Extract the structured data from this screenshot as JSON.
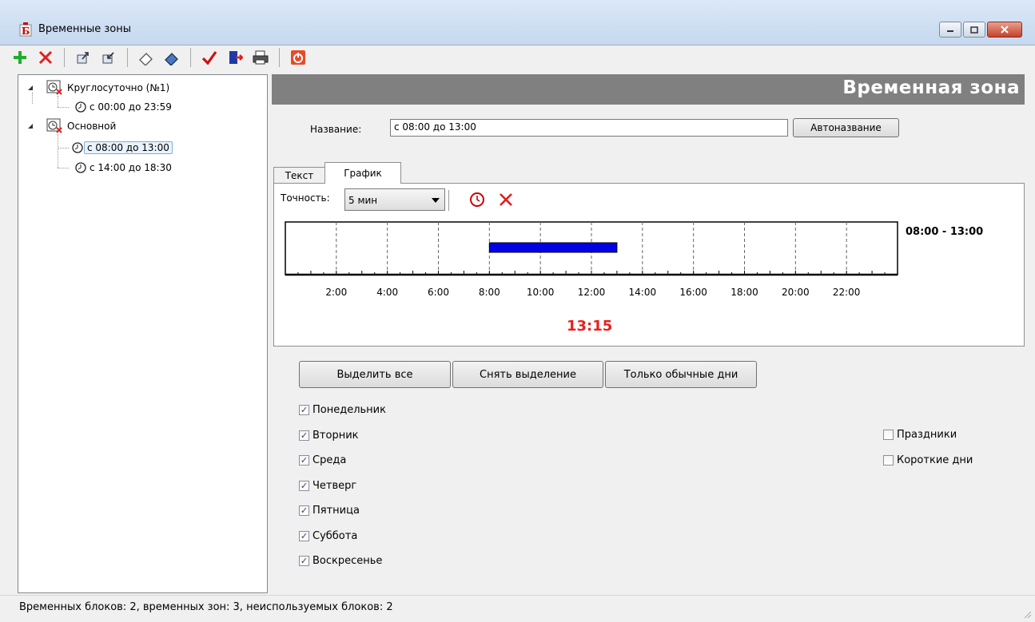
{
  "window": {
    "title": "Временные зоны"
  },
  "toolbar": {
    "buttons": [
      "add-icon",
      "delete-icon",
      "import-icon",
      "export-icon",
      "clear-icon",
      "edit-icon",
      "apply-icon",
      "exit-icon",
      "print-icon",
      "power-icon"
    ]
  },
  "tree": {
    "nodes": [
      {
        "label": "Круглосуточно (№1)",
        "type": "group"
      },
      {
        "label": "с 00:00 до 23:59",
        "type": "block"
      },
      {
        "label": "Основной",
        "type": "group"
      },
      {
        "label": "с 08:00 до 13:00",
        "type": "block",
        "selected": true
      },
      {
        "label": "с 14:00 до 18:30",
        "type": "block"
      }
    ]
  },
  "panel": {
    "header": "Временная зона",
    "name_label": "Название:",
    "name_value": "с 08:00 до 13:00",
    "autoname_button": "Автоназвание",
    "tabs": [
      "Текст",
      "График"
    ],
    "active_tab": "График",
    "precision_label": "Точность:",
    "precision_value": "5 мин"
  },
  "chart_data": {
    "type": "timeline",
    "range_label": "08:00 - 13:00",
    "current_time": "13:15",
    "xlim": [
      0,
      24
    ],
    "tick_labels": [
      "2:00",
      "4:00",
      "6:00",
      "8:00",
      "10:00",
      "12:00",
      "14:00",
      "16:00",
      "18:00",
      "20:00",
      "22:00"
    ],
    "intervals": [
      {
        "start": 8,
        "end": 13
      }
    ],
    "bar_color": "#0000e6",
    "current_time_color": "#e8201c"
  },
  "buttons": {
    "select_all": "Выделить все",
    "deselect": "Снять выделение",
    "weekdays_only": "Только обычные дни"
  },
  "days": [
    {
      "label": "Понедельник",
      "checked": true
    },
    {
      "label": "Вторник",
      "checked": true
    },
    {
      "label": "Среда",
      "checked": true
    },
    {
      "label": "Четверг",
      "checked": true
    },
    {
      "label": "Пятница",
      "checked": true
    },
    {
      "label": "Суббота",
      "checked": true
    },
    {
      "label": "Воскресенье",
      "checked": true
    }
  ],
  "special_days": [
    {
      "label": "Праздники",
      "checked": false
    },
    {
      "label": "Короткие дни",
      "checked": false
    }
  ],
  "status": {
    "text": "Временных блоков: 2, временных зон: 3, неиспользуемых блоков: 2"
  }
}
